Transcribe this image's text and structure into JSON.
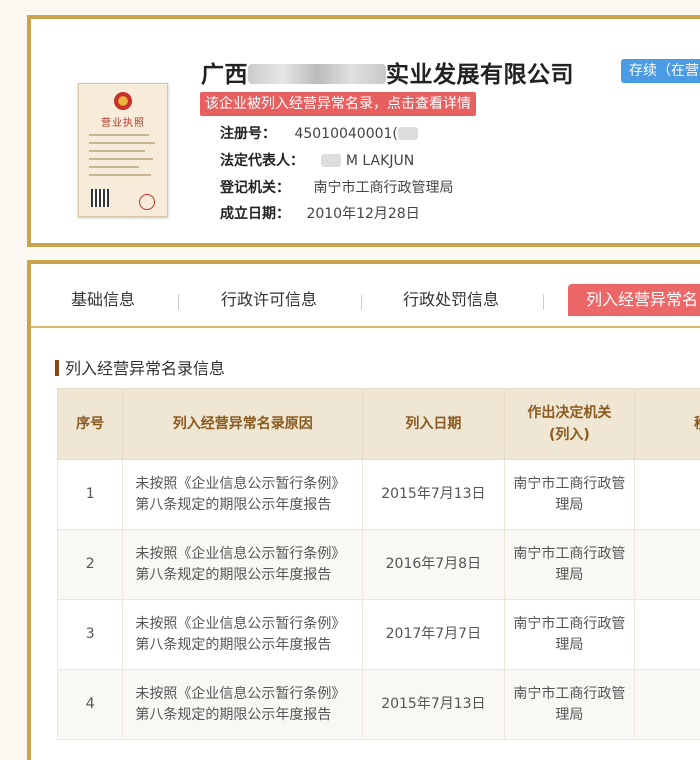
{
  "company": {
    "name_prefix": "广西",
    "name_suffix": "实业发展有限公司",
    "status": "存续（在营",
    "abnormal_alert": "该企业被列入经营异常名录，点击查看详情",
    "license_title": "营业执照"
  },
  "info": [
    {
      "label": "注册号：",
      "value": "45010040001("
    },
    {
      "label": "法定代表人：",
      "value": "M LAKJUN"
    },
    {
      "label": "登记机关：",
      "value": "南宁市工商行政管理局"
    },
    {
      "label": "成立日期：",
      "value": "2010年12月28日"
    }
  ],
  "tabs": [
    "基础信息",
    "行政许可信息",
    "行政处罚信息",
    "列入经营异常名"
  ],
  "section_title": "列入经营异常名录信息",
  "table": {
    "headers": [
      "序号",
      "列入经营异常名录原因",
      "列入日期",
      "作出决定机关\n(列入)",
      "移"
    ],
    "rows": [
      {
        "no": "1",
        "reason": "未按照《企业信息公示暂行条例》第八条规定的期限公示年度报告",
        "date": "2015年7月13日",
        "authority": "南宁市工商行政管理局"
      },
      {
        "no": "2",
        "reason": "未按照《企业信息公示暂行条例》第八条规定的期限公示年度报告",
        "date": "2016年7月8日",
        "authority": "南宁市工商行政管理局"
      },
      {
        "no": "3",
        "reason": "未按照《企业信息公示暂行条例》第八条规定的期限公示年度报告",
        "date": "2017年7月7日",
        "authority": "南宁市工商行政管理局"
      },
      {
        "no": "4",
        "reason": "未按照《企业信息公示暂行条例》第八条规定的期限公示年度报告",
        "date": "2015年7月13日",
        "authority": "南宁市工商行政管理局"
      }
    ]
  },
  "colors": {
    "accent": "#c9a44c",
    "alert": "#e85f5f",
    "status": "#4a9be3"
  }
}
